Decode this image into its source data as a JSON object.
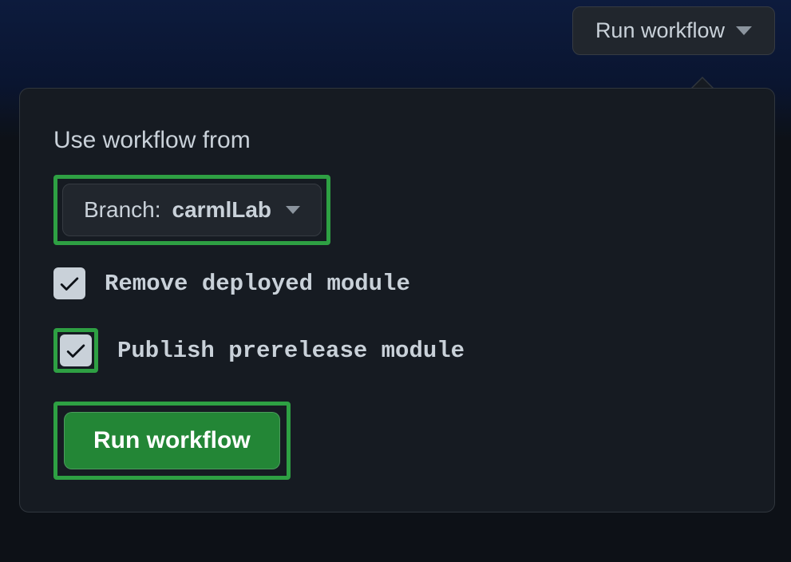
{
  "trigger": {
    "label": "Run workflow"
  },
  "panel": {
    "title": "Use workflow from",
    "branch": {
      "prefix": "Branch: ",
      "name": "carmlLab"
    },
    "options": [
      {
        "label": "Remove deployed module",
        "checked": true,
        "highlighted": false
      },
      {
        "label": "Publish prerelease module",
        "checked": true,
        "highlighted": true
      }
    ],
    "submit_label": "Run workflow"
  },
  "colors": {
    "highlight": "#2ea043",
    "primary_button": "#238636",
    "panel_bg": "#161b22",
    "border": "#30363d"
  }
}
